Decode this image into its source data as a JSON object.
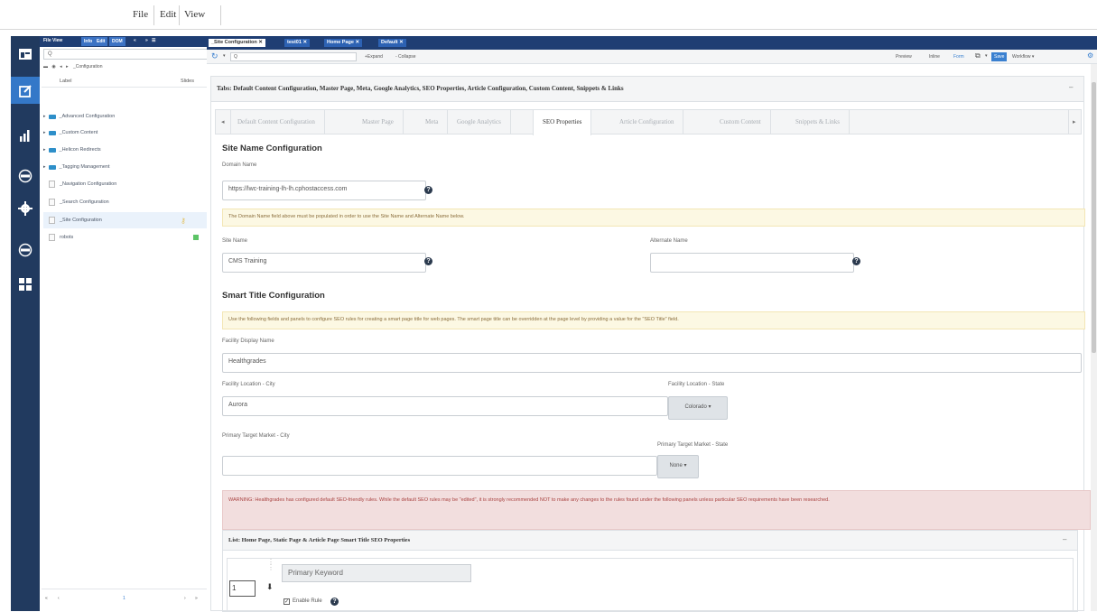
{
  "menubar": {
    "items": [
      "File",
      "Edit",
      "View"
    ]
  },
  "rail": {
    "icons": [
      "layout-icon",
      "edit-icon",
      "analytics-icon",
      "seo-icon",
      "settings-icon",
      "workflow-icon",
      "grid-icon"
    ]
  },
  "explorer": {
    "tabs": [
      "File View",
      "Info",
      "Edit",
      "DOM"
    ],
    "search_placeholder": "Q",
    "breadcrumb": "_Configuration",
    "col_label": "Label",
    "col_slides": "Slides",
    "items": [
      {
        "label": "_Advanced Configuration",
        "type": "folder"
      },
      {
        "label": "_Custom Content",
        "type": "folder"
      },
      {
        "label": "_Helicon Redirects",
        "type": "folder"
      },
      {
        "label": "_Tagging Management",
        "type": "folder"
      },
      {
        "label": "_Navigation Configuration",
        "type": "page"
      },
      {
        "label": "_Search Configuration",
        "type": "page"
      },
      {
        "label": "_Site Configuration",
        "type": "page"
      },
      {
        "label": "robots",
        "type": "page"
      }
    ],
    "pager": {
      "page": "1"
    }
  },
  "doc_tabs": [
    "_Site Configuration",
    "test01",
    "Home Page",
    "Default"
  ],
  "toolbar": {
    "search_placeholder": "Q",
    "expand": "+Expand",
    "collapse": "- Collapse",
    "preview": "Preview",
    "inline": "Inline",
    "form": "Form",
    "save": "Save",
    "workflow": "Workflow"
  },
  "card": {
    "title": "Tabs: Default Content Configuration, Master Page, Meta, Google Analytics, SEO Properties, Article Configuration, Custom Content, Snippets & Links"
  },
  "sub_tabs": [
    "Default Content Configuration",
    "Master Page",
    "Meta",
    "Google Analytics",
    "SEO Properties",
    "Article Configuration",
    "Custom Content",
    "Snippets & Links"
  ],
  "site_name_config": {
    "title": "Site Name Configuration",
    "domain_label": "Domain Name",
    "domain_value": "https://lwc-training-lh-lh.cphostaccess.com",
    "notice": "The Domain Name field above must be populated in order to use the Site Name and Alternate Name below.",
    "site_name_label": "Site Name",
    "site_name_value": "CMS Training",
    "alt_name_label": "Alternate Name",
    "alt_name_value": ""
  },
  "smart_title": {
    "title": "Smart Title Configuration",
    "notice": "Use the following fields and panels to configure SEO rules for creating a smart page title for web pages. The smart page title can be overridden at the page level by providing a value for the \"SEO Title\" field.",
    "facility_label": "Facility Display Name",
    "facility_value": "Healthgrades",
    "city_label": "Facility Location - City",
    "city_value": "Aurora",
    "state_label": "Facility Location - State",
    "state_value": "Colorado",
    "market_city_label": "Primary Target Market - City",
    "market_city_value": "",
    "market_state_label": "Primary Target Market - State",
    "market_state_value": "None",
    "warning": "WARNING: Healthgrades has configured default SEO-friendly rules. While the default SEO rules may be \"edited\", it is strongly recommended NOT to make any changes to the rules found under the following panels unless particular SEO requirements have been researched."
  },
  "list_panel": {
    "title": "List: Home Page, Static Page & Article Page Smart Title SEO Properties",
    "order_value": "1",
    "keyword_value": "Primary Keyword",
    "enable_label": "Enable Rule"
  }
}
